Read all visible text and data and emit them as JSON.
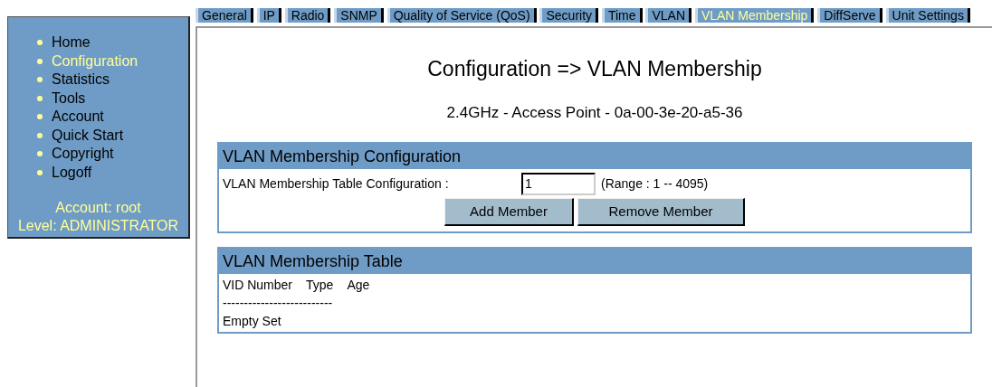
{
  "sidebar": {
    "items": [
      {
        "label": "Home",
        "selected": false
      },
      {
        "label": "Configuration",
        "selected": true
      },
      {
        "label": "Statistics",
        "selected": false
      },
      {
        "label": "Tools",
        "selected": false
      },
      {
        "label": "Account",
        "selected": false
      },
      {
        "label": "Quick Start",
        "selected": false
      },
      {
        "label": "Copyright",
        "selected": false
      },
      {
        "label": "Logoff",
        "selected": false
      }
    ],
    "account": "Account: root",
    "level": "Level: ADMINISTRATOR"
  },
  "tabs": [
    {
      "label": "General",
      "selected": false
    },
    {
      "label": "IP",
      "selected": false
    },
    {
      "label": "Radio",
      "selected": false
    },
    {
      "label": "SNMP",
      "selected": false
    },
    {
      "label": "Quality of Service (QoS)",
      "selected": false
    },
    {
      "label": "Security",
      "selected": false
    },
    {
      "label": "Time",
      "selected": false
    },
    {
      "label": "VLAN",
      "selected": false
    },
    {
      "label": "VLAN Membership",
      "selected": true
    },
    {
      "label": "DiffServe",
      "selected": false
    },
    {
      "label": "Unit Settings",
      "selected": false
    }
  ],
  "title": "Configuration => VLAN Membership",
  "subtitle": "2.4GHz - Access Point - 0a-00-3e-20-a5-36",
  "config_section": {
    "title": "VLAN Membership Configuration",
    "label": "VLAN Membership Table Configuration :",
    "value": "1",
    "range": "(Range : 1 -- 4095)",
    "buttons": [
      "Add Member",
      "Remove Member"
    ]
  },
  "table_section": {
    "title": "VLAN Membership Table",
    "columns": [
      "VID Number",
      "Type",
      "Age"
    ],
    "separator": "--------------------------",
    "empty": "Empty Set"
  }
}
